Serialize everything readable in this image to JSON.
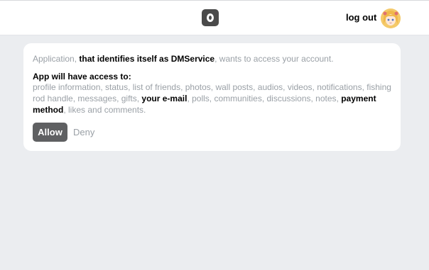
{
  "header": {
    "logo_icon": "app-logo-icon",
    "logout_label": "log out",
    "avatar_icon": "anime-girl-avatar"
  },
  "dialog": {
    "intro_prefix": "Application, ",
    "intro_app": "that identifies itself as DMService",
    "intro_suffix": ", wants to access your account.",
    "access_title": "App will have access to:",
    "permissions_part1": "profile information, status, list of friends, photos, wall posts, audios, videos, notifications, fishing rod handle, messages, gifts, ",
    "permission_email": "your e-mail",
    "permissions_part2": ", polls, communities, discussions, notes, ",
    "permission_payment": "payment method",
    "permissions_part3": ", likes and comments.",
    "allow_label": "Allow",
    "deny_label": "Deny"
  },
  "colors": {
    "background": "#ebedf0",
    "card": "#ffffff",
    "muted_text": "#9aa0a6",
    "allow_button": "#5f6062"
  }
}
